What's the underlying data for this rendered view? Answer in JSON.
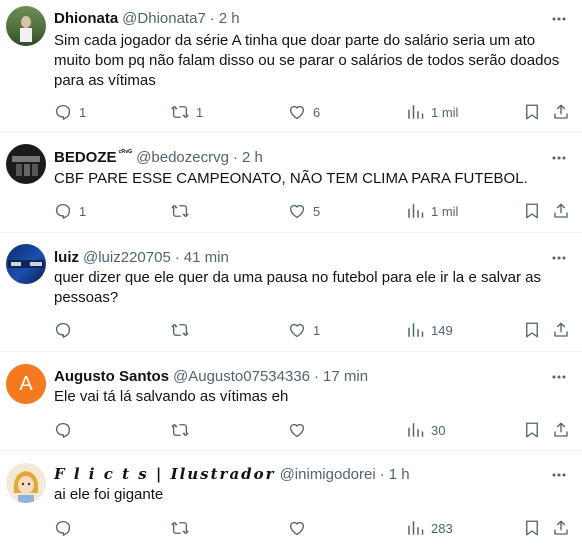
{
  "replies": [
    {
      "name": "Dhionata",
      "badge": "",
      "handle": "@Dhionata7",
      "time": "2 h",
      "text_lines": [
        "Sim cada jogador da série A tinha que doar parte do salário seria um ato",
        "muito bom pq não falam disso ou se parar o salários de todos serão doados",
        "para as vítimas"
      ],
      "stats": {
        "replies": "1",
        "retweets": "1",
        "likes": "6",
        "views": "1 mil"
      }
    },
    {
      "name": "BEDOZE",
      "badge": "ᶜᴿᵛᴳ",
      "handle": "@bedozecrvg",
      "time": "2 h",
      "text_lines": [
        "CBF PARE ESSE CAMPEONATO, NÃO TEM CLIMA PARA FUTEBOL."
      ],
      "stats": {
        "replies": "1",
        "retweets": "",
        "likes": "5",
        "views": "1 mil"
      }
    },
    {
      "name": "luiz",
      "badge": "",
      "handle": "@luiz220705",
      "time": "41 min",
      "text_lines": [
        "quer dizer que ele quer da uma pausa no futebol para ele ir la e salvar as",
        "pessoas?"
      ],
      "stats": {
        "replies": "",
        "retweets": "",
        "likes": "1",
        "views": "149"
      }
    },
    {
      "name": "Augusto Santos",
      "badge": "",
      "handle": "@Augusto07534336",
      "time": "17 min",
      "avatar_letter": "A",
      "text_lines": [
        "Ele vai tá lá salvando as vítimas eh"
      ],
      "stats": {
        "replies": "",
        "retweets": "",
        "likes": "",
        "views": "30"
      }
    },
    {
      "name": "F l i c t s | Ilustrador",
      "badge": "",
      "handle": "@inimigodorei",
      "time": "1 h",
      "text_lines": [
        "ai ele foi gigante"
      ],
      "stats": {
        "replies": "",
        "retweets": "",
        "likes": "",
        "views": "283"
      }
    }
  ],
  "colors": {
    "text": "#0f1419",
    "muted": "#536471",
    "divider": "#eff3f4",
    "avatar_orange": "#f4791f"
  }
}
